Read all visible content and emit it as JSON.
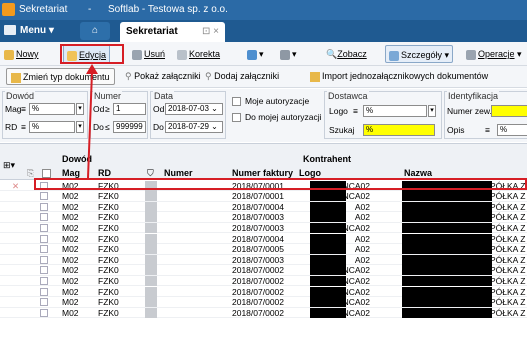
{
  "titlebar": {
    "app": "Sekretariat",
    "sep": "-",
    "company": "Softlab - Testowa sp. z o.o."
  },
  "menu": {
    "label": "Menu",
    "tab": "Sekretariat",
    "tab_close": "⊡ ×"
  },
  "toolbar1": {
    "nowy": "Nowy",
    "edycja": "Edycja",
    "usun": "Usuń",
    "korekta": "Korekta",
    "zobacz": "Zobacz",
    "szczegoly": "Szczegóły",
    "operacje": "Operacje"
  },
  "toolbar2": {
    "zmien": "Zmień typ dokumentu",
    "pokaz": "Pokaż załączniki",
    "dodaj": "Dodaj załączniki",
    "import": "Import jednozałącznikowych dokumentów"
  },
  "filters": {
    "dowod": {
      "legend": "Dowód",
      "mag_label": "Mag",
      "mag_op": "≡",
      "mag_val": "%",
      "rd_label": "RD",
      "rd_op": "≡",
      "rd_val": "%"
    },
    "numer": {
      "legend": "Numer",
      "od_label": "Od",
      "od_op": "≥",
      "od_val": "1",
      "do_label": "Do",
      "do_op": "≤",
      "do_val": "999999"
    },
    "data": {
      "legend": "Data",
      "od_label": "Od",
      "od_val": "2018-07-03",
      "do_label": "Do",
      "do_val": "2018-07-29"
    },
    "moje": "Moje autoryzacje",
    "do_mojej": "Do mojej autoryzacji",
    "dostawca": {
      "legend": "Dostawca",
      "logo_label": "Logo",
      "logo_op": "≡",
      "logo_val": "%",
      "szukaj_label": "Szukaj",
      "szukaj_val": "%"
    },
    "identyfikacja": {
      "legend": "Identyfikacja",
      "numer_label": "Numer zew.",
      "opis_label": "Opis",
      "opis_op": "≡",
      "opis_val": "%"
    }
  },
  "grid": {
    "group_dowod": "Dowód",
    "group_kontrahent": "Kontrahent",
    "columns": {
      "mag": "Mag",
      "rd": "RD",
      "numer": "Numer",
      "faktura": "Numer faktury",
      "logo": "Logo",
      "nazwa": "Nazwa"
    },
    "rows": [
      {
        "mag": "M02",
        "rd": "FZK0",
        "faktura": "2018/07/0001",
        "logo": "NCA02",
        "nazwa": "PÓŁKA Z OGR"
      },
      {
        "mag": "M02",
        "rd": "FZK0",
        "faktura": "2018/07/0001",
        "logo": "NCA02",
        "nazwa": "PÓŁKA Z OGR"
      },
      {
        "mag": "M02",
        "rd": "FZK0",
        "faktura": "2018/07/0004",
        "logo": "A02",
        "nazwa": "PÓŁKA Z OGR"
      },
      {
        "mag": "M02",
        "rd": "FZK0",
        "faktura": "2018/07/0003",
        "logo": "A02",
        "nazwa": "PÓŁKA Z OGR"
      },
      {
        "mag": "M02",
        "rd": "FZK0",
        "faktura": "2018/07/0003",
        "logo": "NCA02",
        "nazwa": "PÓŁKA Z OGR"
      },
      {
        "mag": "M02",
        "rd": "FZK0",
        "faktura": "2018/07/0004",
        "logo": "A02",
        "nazwa": "PÓŁKA Z OGR"
      },
      {
        "mag": "M02",
        "rd": "FZK0",
        "faktura": "2018/07/0005",
        "logo": "A02",
        "nazwa": "PÓŁKA Z OGR"
      },
      {
        "mag": "M02",
        "rd": "FZK0",
        "faktura": "2018/07/0003",
        "logo": "A02",
        "nazwa": "PÓŁKA Z OGR"
      },
      {
        "mag": "M02",
        "rd": "FZK0",
        "faktura": "2018/07/0002",
        "logo": "NCA02",
        "nazwa": "PÓŁKA Z OGR"
      },
      {
        "mag": "M02",
        "rd": "FZK0",
        "faktura": "2018/07/0002",
        "logo": "NCA02",
        "nazwa": "PÓŁKA Z OGR"
      },
      {
        "mag": "M02",
        "rd": "FZK0",
        "faktura": "2018/07/0002",
        "logo": "NCA02",
        "nazwa": "PÓŁKA Z OGR"
      },
      {
        "mag": "M02",
        "rd": "FZK0",
        "faktura": "2018/07/0002",
        "logo": "NCA02",
        "nazwa": "PÓŁKA Z OGR"
      },
      {
        "mag": "M02",
        "rd": "FZK0",
        "faktura": "2018/07/0002",
        "logo": "NCA02",
        "nazwa": "PÓŁKA Z OGR"
      }
    ]
  },
  "colors": {
    "titlebar": "#2b6aa6",
    "menubar": "#1f5a91",
    "highlight": "#d61e25",
    "yellow": "#ffff00"
  }
}
